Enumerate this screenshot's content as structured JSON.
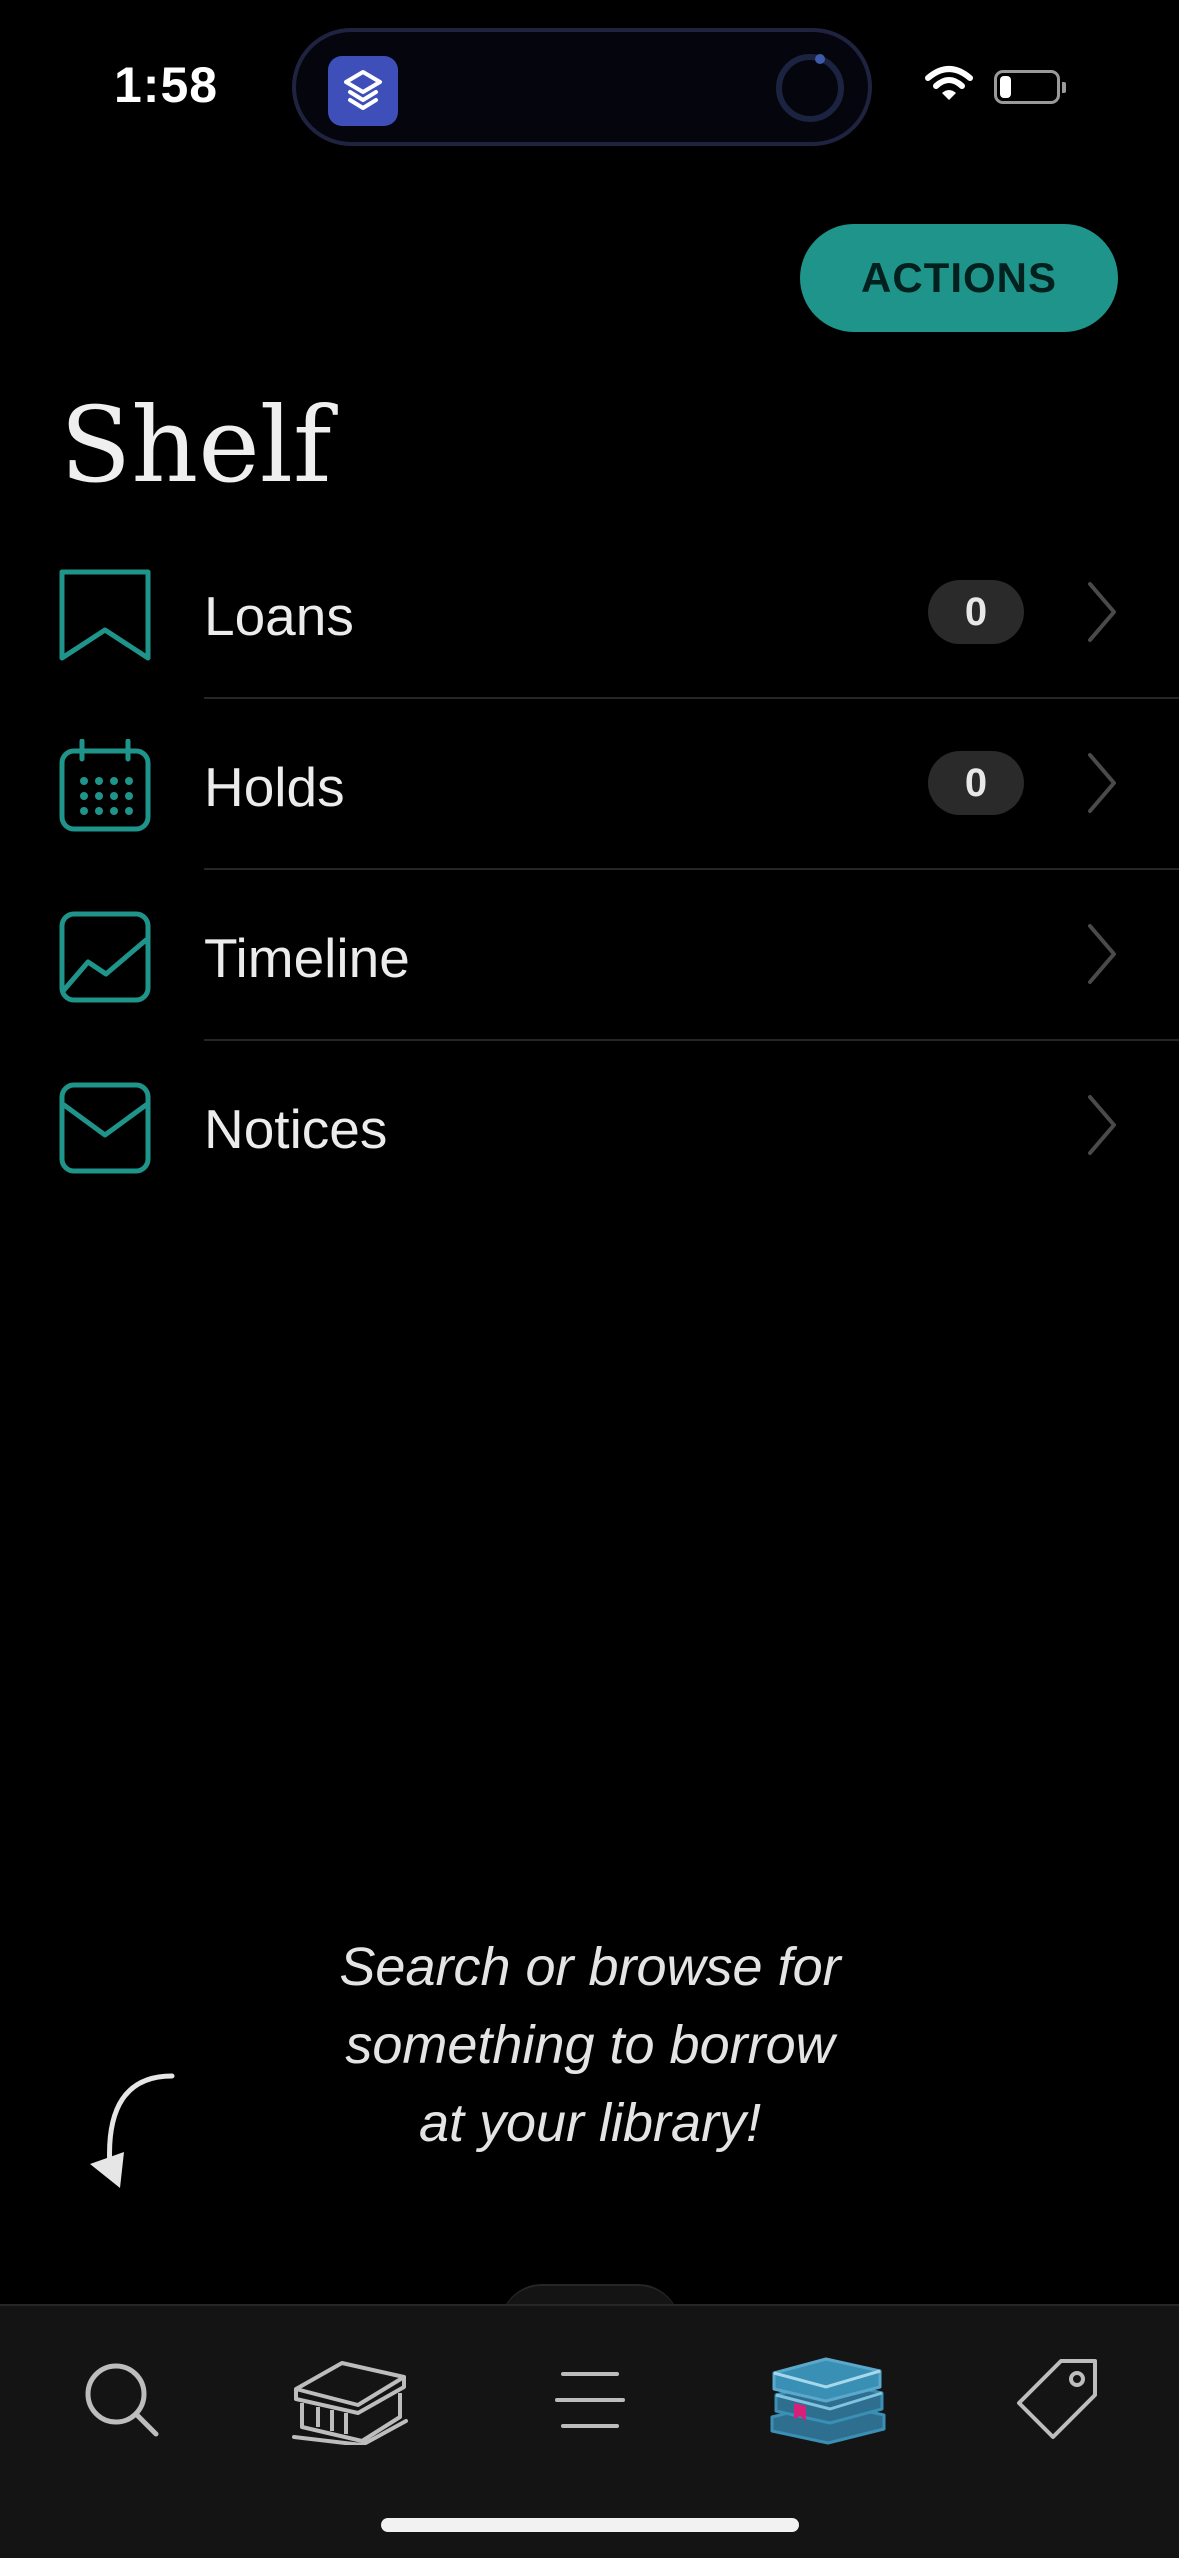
{
  "status_bar": {
    "time": "1:58"
  },
  "header": {
    "actions_label": "ACTIONS",
    "title": "Shelf"
  },
  "shelf_items": [
    {
      "label": "Loans",
      "count": "0",
      "icon": "bookmark-icon"
    },
    {
      "label": "Holds",
      "count": "0",
      "icon": "calendar-icon"
    },
    {
      "label": "Timeline",
      "icon": "chart-icon"
    },
    {
      "label": "Notices",
      "icon": "envelope-icon"
    }
  ],
  "empty_state": {
    "line1": "Search or browse for",
    "line2": "something to borrow",
    "line3": "at your library!"
  },
  "tab_bar": {
    "tabs": [
      {
        "icon": "search-icon"
      },
      {
        "icon": "library-icon"
      },
      {
        "icon": "menu-icon"
      },
      {
        "icon": "shelf-books-icon",
        "active": true
      },
      {
        "icon": "tag-icon"
      }
    ]
  },
  "colors": {
    "accent": "#1f948a",
    "background": "#000000",
    "tab_bar": "#141414",
    "active_tab": "#3a8fb5",
    "bookmark_accent": "#d6207a"
  }
}
